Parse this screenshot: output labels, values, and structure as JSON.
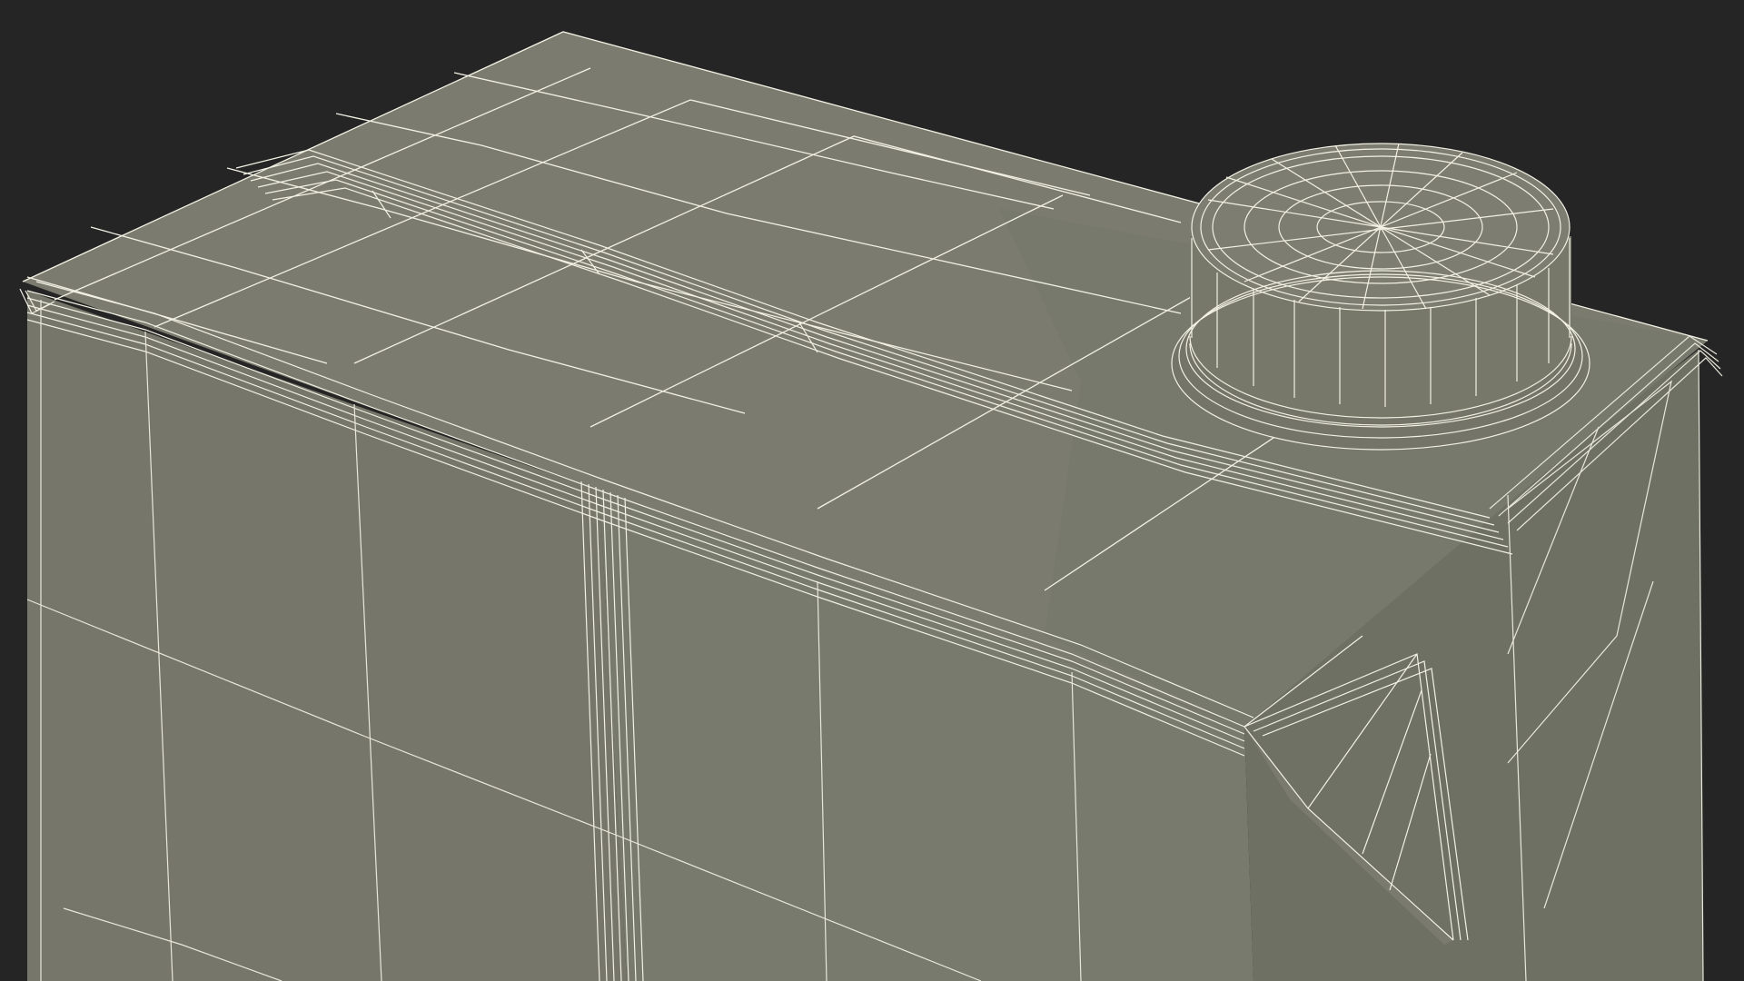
{
  "scene": {
    "subject": "carton-with-screw-cap-wireframe",
    "colors": {
      "background": "#252525",
      "surface_top": "#7b7c6f",
      "surface_left": "#76776a",
      "surface_front": "#787a6d",
      "surface_right": "#6f7064",
      "cap_side": "#777869",
      "cap_top": "#7d7e71",
      "wire": "#f2f1e4",
      "wire_soft": "#dcdbcf"
    }
  }
}
